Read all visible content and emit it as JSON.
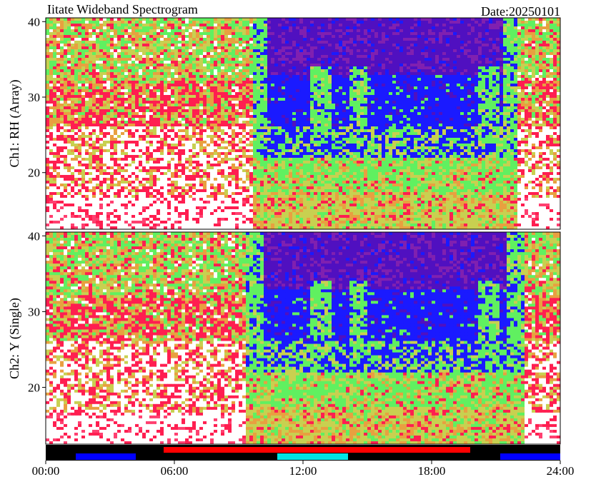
{
  "chart_data": {
    "type": "heatmap",
    "title": "Iitate Wideband Spectrogram",
    "date_label": "Date:20250101",
    "x_ticks": [
      "00:00",
      "06:00",
      "12:00",
      "18:00",
      "24:00"
    ],
    "x_range_hours": [
      0,
      24
    ],
    "grid": false,
    "panels": [
      {
        "ylabel": "Ch1: RH (Array)",
        "ylim": [
          12.5,
          40.5
        ],
        "y_ticks": [
          20,
          30,
          40
        ],
        "day_side_hours": [
          9.6,
          22
        ]
      },
      {
        "ylabel": "Ch2: Y (Single)",
        "ylim": [
          12.5,
          40.5
        ],
        "y_ticks": [
          20,
          30,
          40
        ],
        "day_side_hours": [
          9.4,
          22.3
        ]
      }
    ],
    "status_bar": {
      "lower": [
        {
          "start": 1.4,
          "end": 4.2,
          "color": "#0000ff"
        },
        {
          "start": 10.8,
          "end": 14.1,
          "color": "#00e5e5"
        },
        {
          "start": 21.2,
          "end": 24.0,
          "color": "#0000ff"
        }
      ],
      "upper": [
        {
          "start": 5.5,
          "end": 19.8,
          "color": "#ff0000"
        }
      ],
      "base_color": "#000000"
    },
    "palette": [
      "#ffffff",
      "#ff1e50",
      "#ff4070",
      "#e8a040",
      "#c8d050",
      "#60f060",
      "#1a1aff",
      "#5010c0",
      "#8020b0"
    ]
  }
}
